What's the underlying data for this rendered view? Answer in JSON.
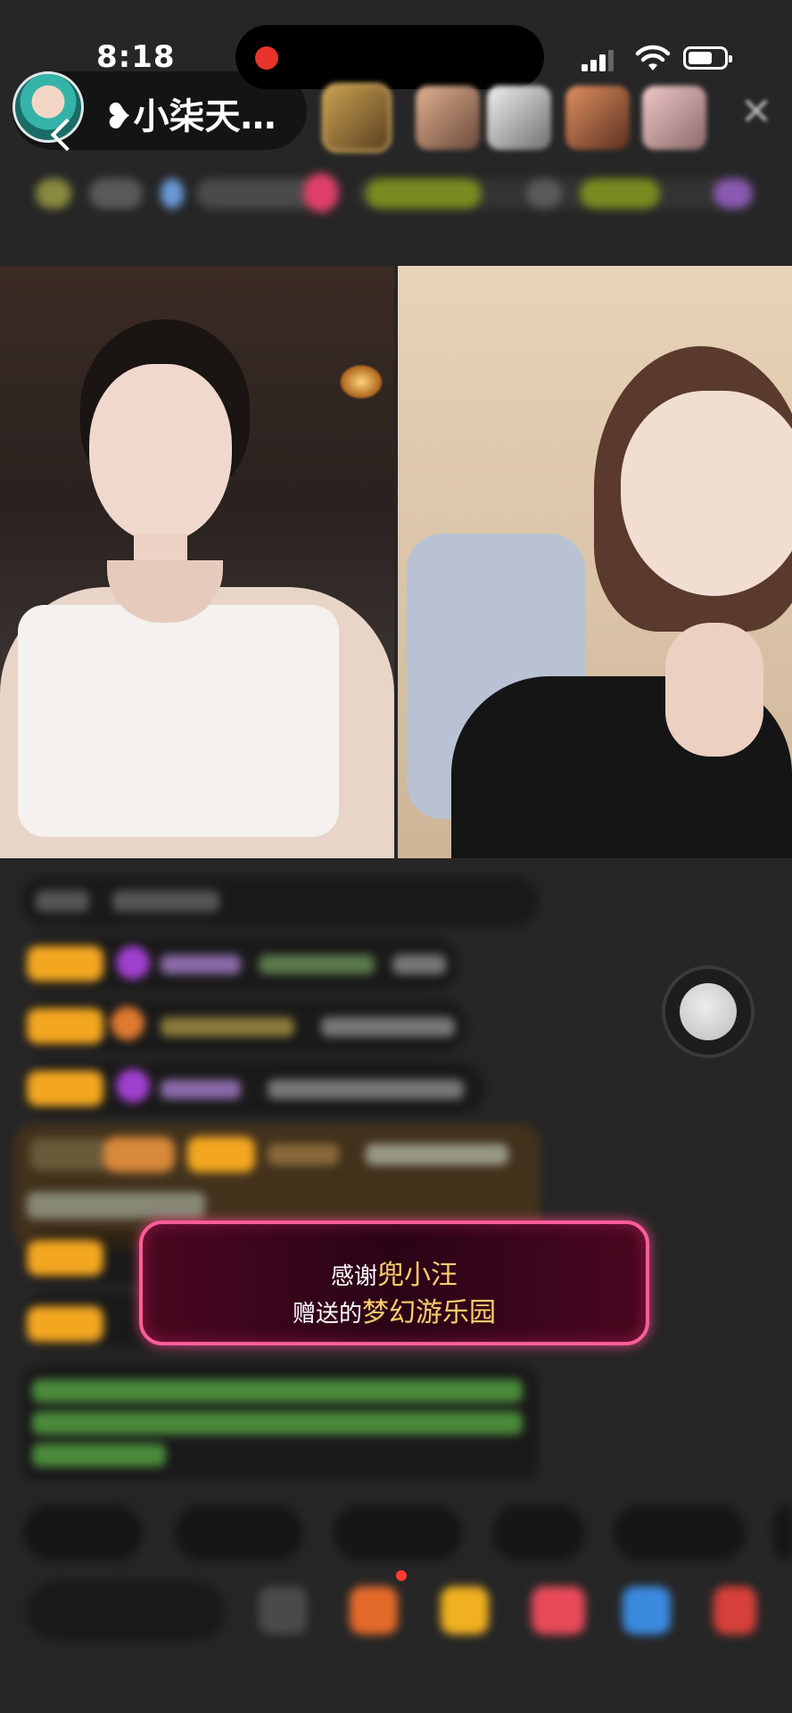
{
  "status_bar": {
    "time": "8:18"
  },
  "header": {
    "host_name": "❥小柒天…"
  },
  "gift_banner": {
    "thanks_prefix": "感谢",
    "sender": "兜小汪",
    "gift_prefix": "赠送的",
    "gift_name": "梦幻游乐园"
  },
  "colors": {
    "banner_border": "#ff5d99",
    "badge": "#f3a720",
    "gift_highlight": "#ffce6b",
    "recording": "#e8332b"
  }
}
